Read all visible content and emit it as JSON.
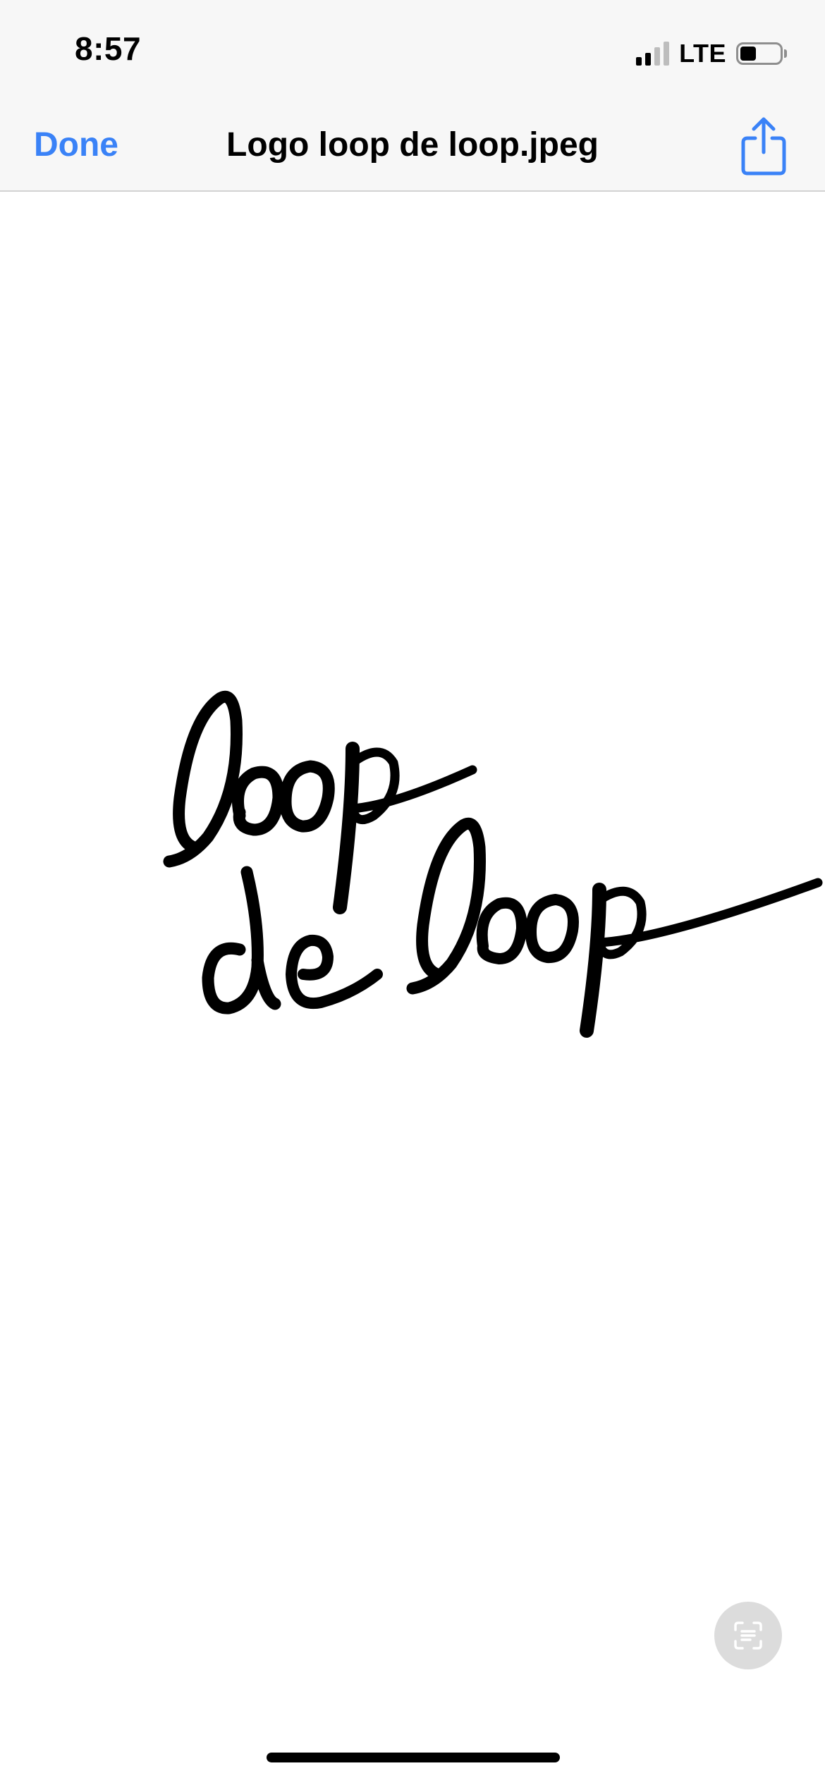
{
  "status_bar": {
    "time": "8:57",
    "network": "LTE",
    "signal_bars_active": 2,
    "signal_bars_total": 4,
    "battery_level": 0.4,
    "signal_icon": "cellular-signal-icon",
    "battery_icon": "battery-icon"
  },
  "nav": {
    "done_label": "Done",
    "title": "Logo loop de loop.jpeg",
    "share_icon": "share-icon"
  },
  "viewer": {
    "image_text": "loop de loop",
    "live_text_icon": "live-text-icon"
  },
  "colors": {
    "accent": "#3a82f7",
    "bar_background": "#f7f7f7",
    "ink": "#000000"
  }
}
